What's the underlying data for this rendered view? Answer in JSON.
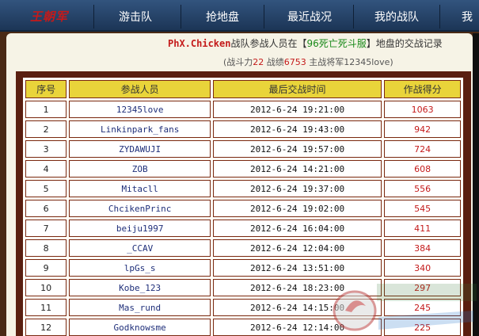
{
  "logo": {
    "text": "王朝军"
  },
  "nav": {
    "items": [
      {
        "label": "游击队"
      },
      {
        "label": "抢地盘"
      },
      {
        "label": "最近战况"
      },
      {
        "label": "我的战队"
      },
      {
        "label": "我"
      }
    ]
  },
  "record": {
    "team_name": "PhX.Chicken",
    "title_mid": "战队参战人员在【",
    "server": "96死亡死斗服",
    "title_end": "】地盘的交战记录",
    "sub_prefix": "(战斗力",
    "power": "22",
    "sub_mid": " 战绩",
    "score_total": "6753",
    "sub_suffix": " 主战将军12345love)"
  },
  "table": {
    "headers": [
      "序号",
      "参战人员",
      "最后交战时间",
      "作战得分"
    ],
    "rows": [
      {
        "idx": "1",
        "name": "12345love",
        "time": "2012-6-24 19:21:00",
        "score": "1063"
      },
      {
        "idx": "2",
        "name": "Linkinpark_fans",
        "time": "2012-6-24 19:43:00",
        "score": "942"
      },
      {
        "idx": "3",
        "name": "ZYDAWUJI",
        "time": "2012-6-24 19:57:00",
        "score": "724"
      },
      {
        "idx": "4",
        "name": "ZOB",
        "time": "2012-6-24 14:21:00",
        "score": "608"
      },
      {
        "idx": "5",
        "name": "Mitacll",
        "time": "2012-6-24 19:37:00",
        "score": "556"
      },
      {
        "idx": "6",
        "name": "ChcikenPrinc",
        "time": "2012-6-24 19:02:00",
        "score": "545"
      },
      {
        "idx": "7",
        "name": "beiju1997",
        "time": "2012-6-24 16:04:00",
        "score": "411"
      },
      {
        "idx": "8",
        "name": "_CCAV",
        "time": "2012-6-24 12:04:00",
        "score": "384"
      },
      {
        "idx": "9",
        "name": "lpGs_s",
        "time": "2012-6-24 13:51:00",
        "score": "340"
      },
      {
        "idx": "10",
        "name": "Kobe_123",
        "time": "2012-6-24 18:23:00",
        "score": "297"
      },
      {
        "idx": "11",
        "name": "Mas_rund",
        "time": "2012-6-24 14:15:00",
        "score": "245"
      },
      {
        "idx": "12",
        "name": "Godknowsme",
        "time": "2012-6-24 12:14:00",
        "score": "225"
      }
    ]
  },
  "colors": {
    "nav_bg": "#1c3556",
    "header_bg": "#e9d43a",
    "score": "#c41a1a",
    "name": "#1f2f7a",
    "frame": "#5a1f10"
  }
}
